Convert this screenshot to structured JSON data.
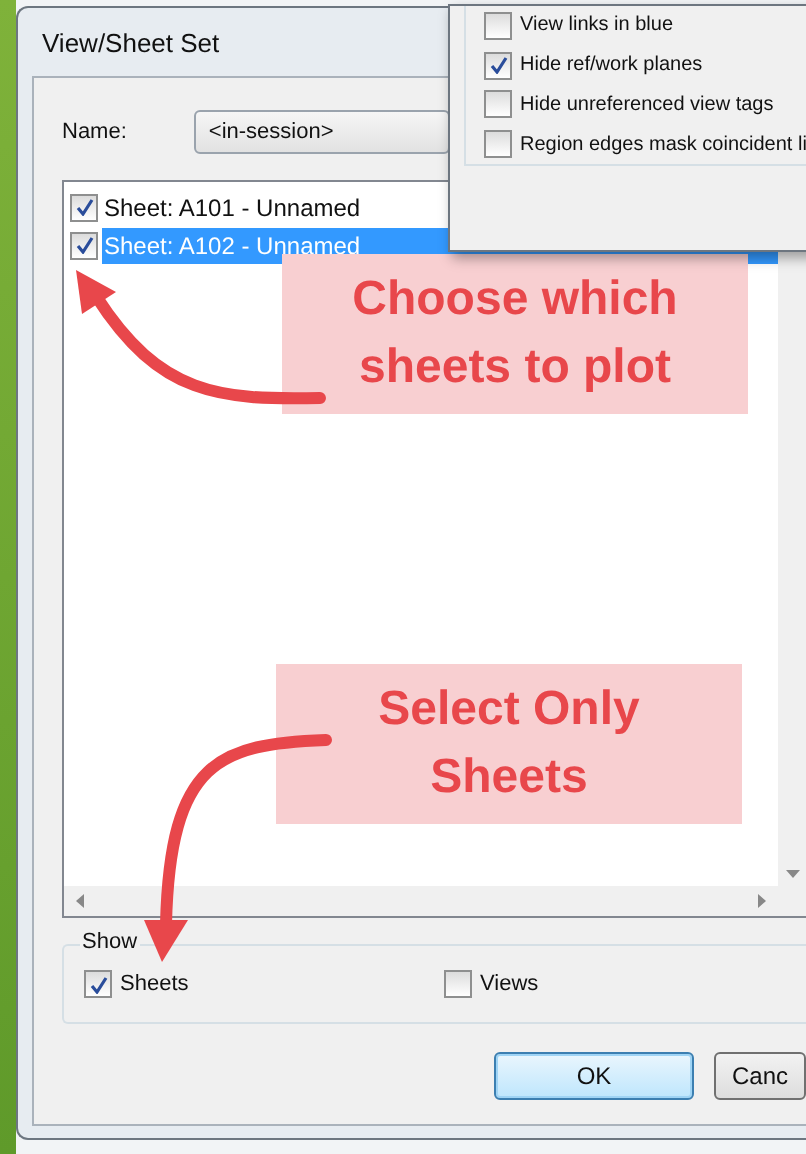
{
  "dialog": {
    "title": "View/Sheet Set",
    "name_label": "Name:",
    "name_value": "<in-session>",
    "sheets": [
      {
        "label": "Sheet: A101 - Unnamed",
        "checked": true,
        "selected": false
      },
      {
        "label": "Sheet: A102 - Unnamed",
        "checked": true,
        "selected": true
      }
    ],
    "show": {
      "title": "Show",
      "options": [
        {
          "label": "Sheets",
          "checked": true
        },
        {
          "label": "Views",
          "checked": false
        }
      ]
    },
    "buttons": [
      {
        "label": "OK",
        "default": true
      },
      {
        "label": "Canc",
        "default": false
      }
    ]
  },
  "overlay_window": {
    "options": [
      {
        "label": "View links in blue",
        "checked": false
      },
      {
        "label": "Hide ref/work planes",
        "checked": true
      },
      {
        "label": "Hide unreferenced view tags",
        "checked": false
      },
      {
        "label": "Region edges mask coincident li",
        "checked": false
      }
    ]
  },
  "annotations": [
    {
      "text": "Choose which sheets to plot"
    },
    {
      "text": "Select Only Sheets"
    }
  ]
}
